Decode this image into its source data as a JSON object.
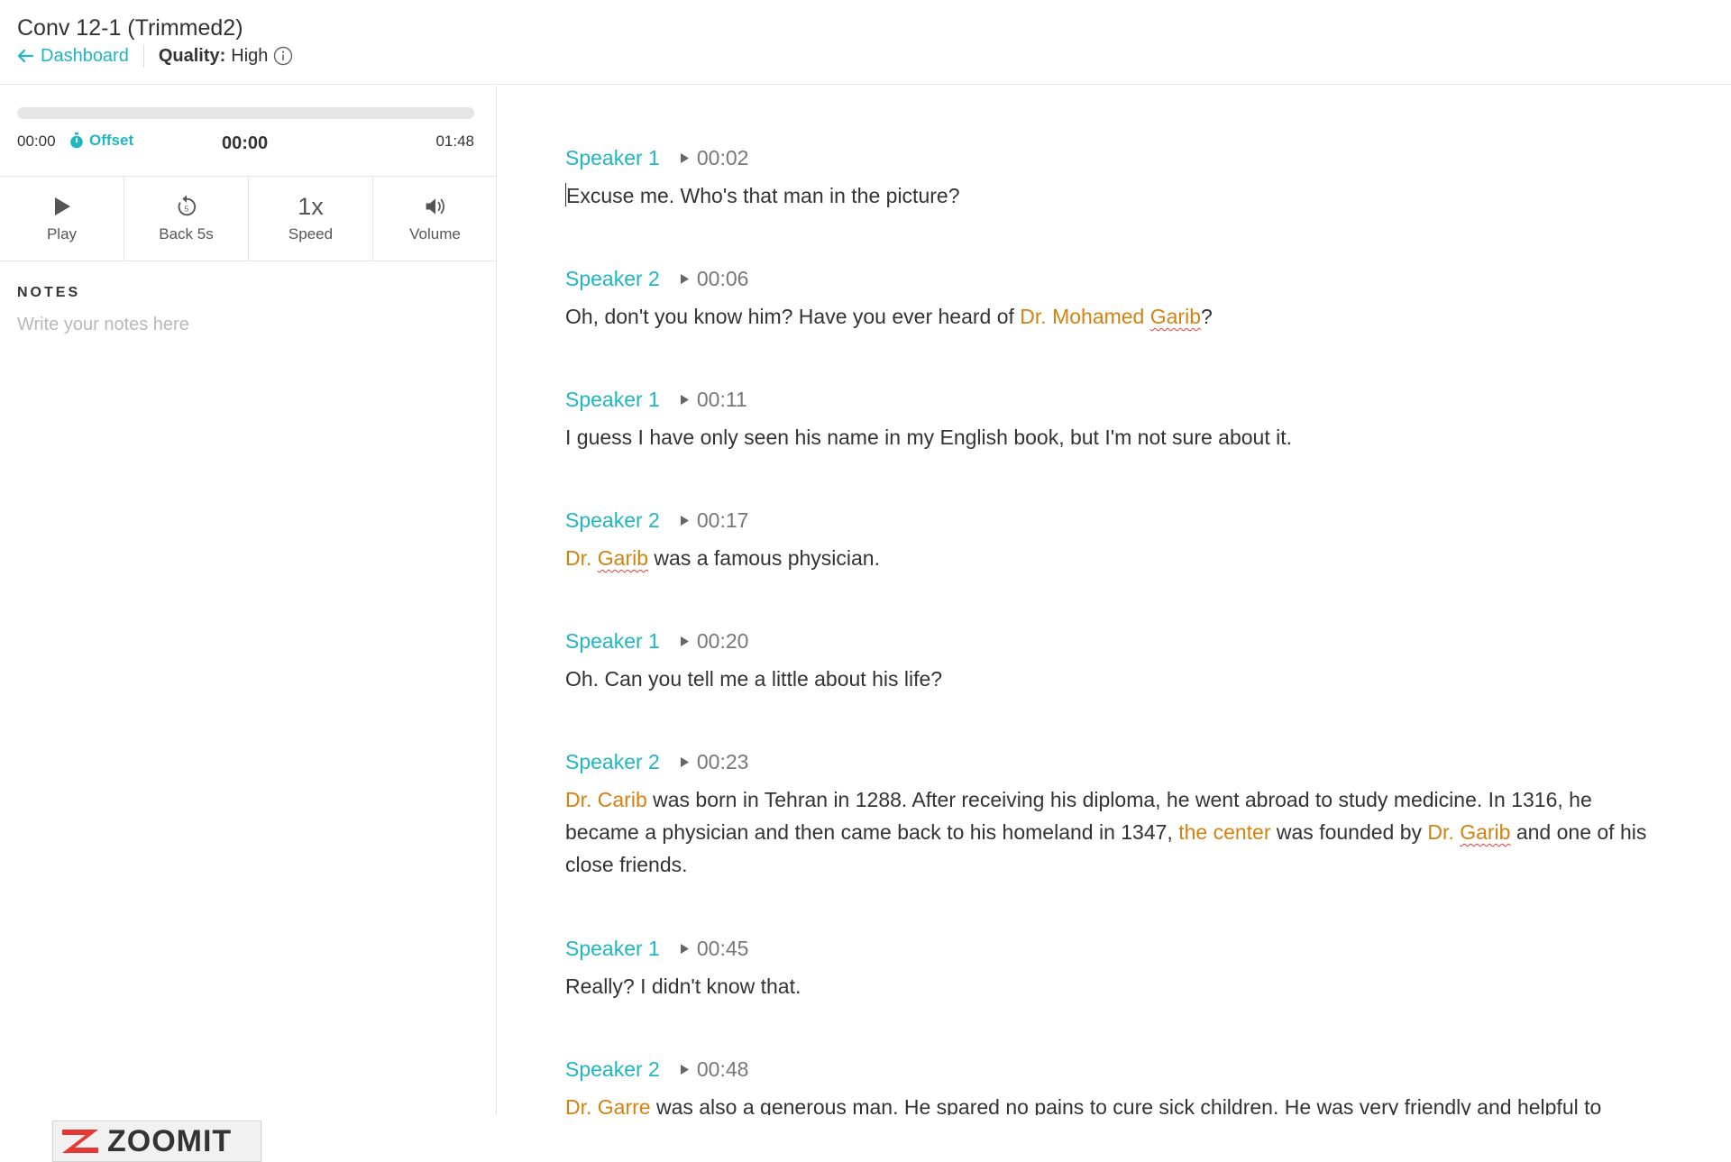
{
  "header": {
    "title": "Conv 12-1 (Trimmed2)",
    "back_label": "Dashboard",
    "quality_label": "Quality:",
    "quality_value": "High"
  },
  "player": {
    "time_start": "00:00",
    "offset_label": "Offset",
    "time_current": "00:00",
    "time_end": "01:48",
    "progress": 0,
    "controls": {
      "play": "Play",
      "back": "Back 5s",
      "speed_value": "1x",
      "speed": "Speed",
      "volume": "Volume"
    }
  },
  "notes": {
    "title": "NOTES",
    "placeholder": "Write your notes here"
  },
  "logo": {
    "text": "ZOOMIT"
  },
  "colors": {
    "accent": "#1fb6c1",
    "entity": "#d4820f",
    "spellcheck": "#e53935"
  },
  "segments": [
    {
      "speaker": "Speaker 1",
      "time": "00:02",
      "parts": [
        {
          "t": "Excuse me. Who's that man in the picture?"
        }
      ]
    },
    {
      "speaker": "Speaker 2",
      "time": "00:06",
      "parts": [
        {
          "t": "Oh, don't you know him? Have you ever heard of "
        },
        {
          "t": "Dr. Mohamed ",
          "ent": true
        },
        {
          "t": "Garib",
          "ent": true,
          "sp": true
        },
        {
          "t": "?"
        }
      ]
    },
    {
      "speaker": "Speaker 1",
      "time": "00:11",
      "parts": [
        {
          "t": "I guess I have only seen his name in my English book, but I'm not sure about it."
        }
      ]
    },
    {
      "speaker": "Speaker 2",
      "time": "00:17",
      "parts": [
        {
          "t": "Dr. ",
          "ent": true
        },
        {
          "t": "Garib",
          "ent": true,
          "sp": true
        },
        {
          "t": " was a famous physician."
        }
      ]
    },
    {
      "speaker": "Speaker 1",
      "time": "00:20",
      "parts": [
        {
          "t": "Oh. Can you tell me a little about his life?"
        }
      ]
    },
    {
      "speaker": "Speaker 2",
      "time": "00:23",
      "parts": [
        {
          "t": "Dr. Carib",
          "ent": true
        },
        {
          "t": " was born in Tehran in 1288. After receiving his diploma, he went abroad to study medicine. In 1316, he became a physician and then came back to his homeland in 1347, "
        },
        {
          "t": "the center",
          "ent": true
        },
        {
          "t": " was founded by "
        },
        {
          "t": "Dr. ",
          "ent": true
        },
        {
          "t": "Garib",
          "ent": true,
          "sp": true
        },
        {
          "t": " and one of his close friends."
        }
      ]
    },
    {
      "speaker": "Speaker 1",
      "time": "00:45",
      "parts": [
        {
          "t": "Really? I didn't know that."
        }
      ]
    },
    {
      "speaker": "Speaker 2",
      "time": "00:48",
      "parts": [
        {
          "t": "Dr. Garre",
          "ent": true
        },
        {
          "t": " was also a generous man. He spared no pains to cure sick children. He was very friendly and helpful to"
        }
      ]
    }
  ]
}
